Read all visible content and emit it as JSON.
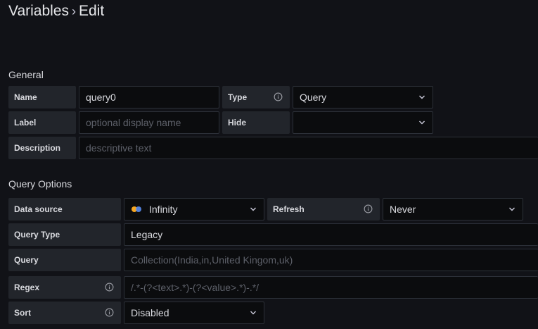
{
  "header": {
    "title": "Variables",
    "subtitle": "Edit"
  },
  "general": {
    "heading": "General",
    "name": {
      "label": "Name",
      "value": "query0"
    },
    "type": {
      "label": "Type",
      "value": "Query"
    },
    "label_field": {
      "label": "Label",
      "placeholder": "optional display name"
    },
    "hide": {
      "label": "Hide",
      "value": ""
    },
    "description": {
      "label": "Description",
      "placeholder": "descriptive text"
    }
  },
  "query_options": {
    "heading": "Query Options",
    "data_source": {
      "label": "Data source",
      "value": "Infinity"
    },
    "refresh": {
      "label": "Refresh",
      "value": "Never"
    },
    "query_type": {
      "label": "Query Type",
      "value": "Legacy"
    },
    "query": {
      "label": "Query",
      "placeholder": "Collection(India,in,United Kingom,uk)"
    },
    "regex": {
      "label": "Regex",
      "placeholder": "/.*-(?<text>.*)-(?<value>.*)-.*/"
    },
    "sort": {
      "label": "Sort",
      "value": "Disabled"
    }
  },
  "icons": {
    "info": "info-circle-icon",
    "chevron": "chevron-down-icon",
    "datasource": "infinity-datasource-icon"
  },
  "colors": {
    "background": "#111217",
    "label_bg": "#22252b",
    "field_bg": "#0b0c0e",
    "border": "#2c3038",
    "logo_orange": "#f5a623",
    "logo_blue": "#5a8dee"
  }
}
